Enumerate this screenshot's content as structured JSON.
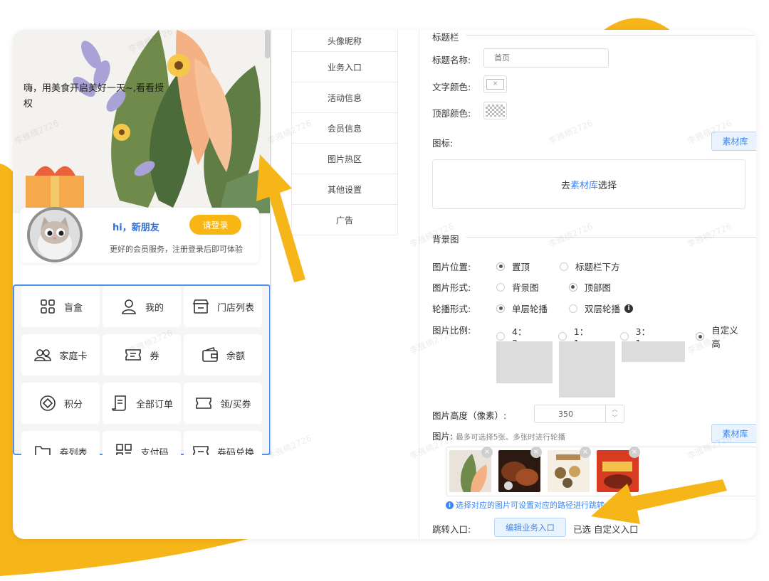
{
  "phone": {
    "greeting": "嗨，用美食开启美好一天~,看看授权",
    "member": {
      "hi": "hi，新朋友",
      "login": "请登录",
      "tip": "更好的会员服务，注册登录后即可体验"
    },
    "grid": [
      {
        "label": "盲盒",
        "icon": "apps-grid-icon"
      },
      {
        "label": "我的",
        "icon": "user-icon"
      },
      {
        "label": "门店列表",
        "icon": "store-icon"
      },
      {
        "label": "家庭卡",
        "icon": "family-icon"
      },
      {
        "label": "券",
        "icon": "ticket-icon"
      },
      {
        "label": "余额",
        "icon": "wallet-icon"
      },
      {
        "label": "积分",
        "icon": "points-icon"
      },
      {
        "label": "全部订单",
        "icon": "order-icon"
      },
      {
        "label": "领/买券",
        "icon": "coupon-icon"
      },
      {
        "label": "券列表",
        "icon": "folder-icon"
      },
      {
        "label": "支付码",
        "icon": "qrcode-icon"
      },
      {
        "label": "券码兑换",
        "icon": "exchange-icon"
      }
    ]
  },
  "tabs": [
    "头像昵称",
    "业务入口",
    "活动信息",
    "会员信息",
    "图片热区",
    "其他设置",
    "广告"
  ],
  "settings": {
    "title_bar": {
      "section": "标题栏",
      "name_label": "标题名称:",
      "name_placeholder": "首页",
      "text_color_label": "文字颜色:",
      "top_color_label": "顶部颜色:",
      "icon_label": "图标:",
      "library_btn": "素材库",
      "pick_prefix": "去",
      "pick_link": "素材库",
      "pick_suffix": "选择"
    },
    "background": {
      "section": "背景图",
      "position_label": "图片位置:",
      "position_options": [
        "置顶",
        "标题栏下方"
      ],
      "form_label": "图片形式:",
      "form_options": [
        "背景图",
        "顶部图"
      ],
      "carousel_label": "轮播形式:",
      "carousel_options": [
        "单层轮播",
        "双层轮播"
      ],
      "ratio_label": "图片比例:",
      "ratio_options": [
        "4：3",
        "1：1",
        "3：1",
        "自定义高"
      ],
      "height_label": "图片高度（像素）:",
      "height_value": "350",
      "images_label": "图片:",
      "images_hint": "最多可选择5张。多张时进行轮播",
      "library_btn": "素材库",
      "tip": "选择对应的图片可设置对应的路径进行跳转",
      "jump_label": "跳转入口:",
      "jump_btn": "编辑业务入口",
      "jump_selected": "已选 自定义入口"
    }
  },
  "watermark": "李雅楠2726",
  "colors": {
    "accent_blue": "#3d86f0",
    "login_yellow": "#f7b614",
    "deco_yellow": "#f6b519",
    "grid_border": "#4d90f0"
  }
}
